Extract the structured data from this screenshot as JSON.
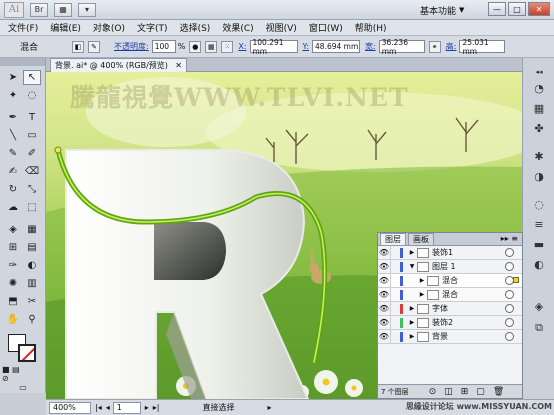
{
  "app": {
    "logo": "Ai",
    "workspace": "基本功能",
    "window_buttons": [
      "—",
      "□",
      "✕"
    ],
    "title_bar_button_icons": [
      "bridge-icon",
      "arrange-icon",
      "layout-icon"
    ]
  },
  "menu": [
    "文件(F)",
    "编辑(E)",
    "对象(O)",
    "文字(T)",
    "选择(S)",
    "效果(C)",
    "视图(V)",
    "窗口(W)",
    "帮助(H)"
  ],
  "control": {
    "object_type": "混合",
    "opacity_label": "不透明度:",
    "opacity_value": "100",
    "opacity_unit": "%",
    "x_label": "X:",
    "x_value": "100.291 mm",
    "y_label": "Y:",
    "y_value": "48.694 mm",
    "w_label": "宽:",
    "w_value": "36.236 mm",
    "h_label": "高:",
    "h_value": "25.031 mm"
  },
  "document": {
    "tab_title": "背景. ai* @ 400% (RGB/预览)",
    "tab_close": "✕",
    "watermark": "騰龍視覺WWW.TLVI.NET"
  },
  "layers_panel": {
    "tabs": [
      "图层",
      "画板"
    ],
    "menu": "▸▸ ≡",
    "rows": [
      {
        "name": "装饰1",
        "color": "#3e5fd6",
        "sub": false,
        "expanded": false,
        "selected": false
      },
      {
        "name": "图层 1",
        "color": "#3e5fd6",
        "sub": false,
        "expanded": true,
        "selected": false
      },
      {
        "name": "混合",
        "color": "#3e5fd6",
        "sub": true,
        "expanded": false,
        "selected": true
      },
      {
        "name": "混合",
        "color": "#3e5fd6",
        "sub": true,
        "expanded": false,
        "selected": false
      },
      {
        "name": "字体",
        "color": "#d63e3e",
        "sub": false,
        "expanded": false,
        "selected": false
      },
      {
        "name": "装饰2",
        "color": "#3ec25a",
        "sub": false,
        "expanded": false,
        "selected": false
      },
      {
        "name": "背景",
        "color": "#3e5fd6",
        "sub": false,
        "expanded": false,
        "selected": false
      }
    ],
    "footer_count": "7 个图层"
  },
  "status": {
    "zoom": "400%",
    "artboard": "1",
    "tool": "直接选择",
    "site": "思缘设计论坛 www.MISSYUAN.COM"
  },
  "colors": {
    "accent": "#1a3ea8",
    "green_path": "#6fb81f",
    "letter_fill": "#f2f4ee"
  }
}
